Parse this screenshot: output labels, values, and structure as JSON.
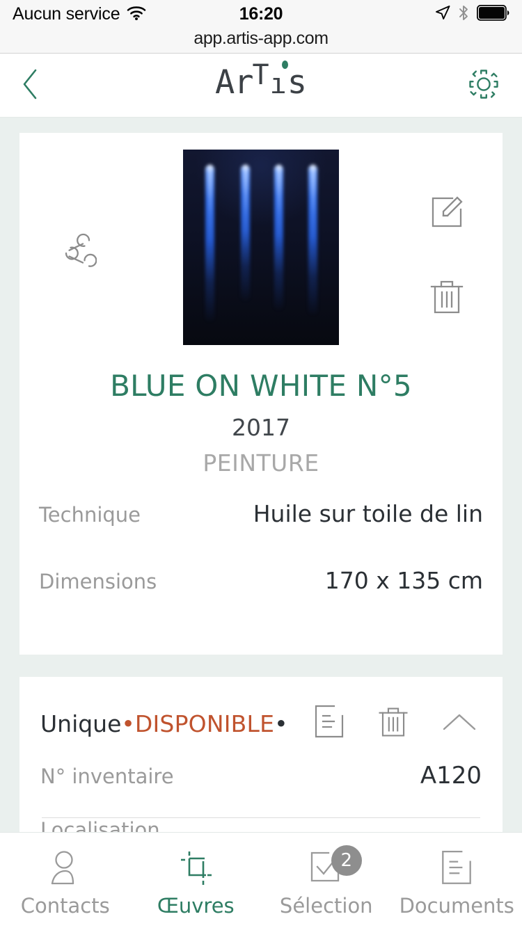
{
  "status_bar": {
    "carrier": "Aucun service",
    "time": "16:20",
    "icons": [
      "wifi-icon",
      "location-arrow-icon",
      "bluetooth-icon",
      "battery-icon"
    ]
  },
  "browser": {
    "url": "app.artis-app.com"
  },
  "header": {
    "back_icon": "chevron-left-icon",
    "logo": {
      "part1": "Ar",
      "part2": "T",
      "part3": "ı",
      "part4": "s"
    },
    "settings_icon": "gear-icon",
    "accent_green": "#2e7d63"
  },
  "artwork": {
    "share_icon": "share-icon",
    "edit_icon": "edit-icon",
    "delete_icon": "trash-icon",
    "image_alt": "blue-on-white-painting-thumbnail",
    "title": "BLUE ON WHITE N°5",
    "year": "2017",
    "category": "PEINTURE",
    "attributes": [
      {
        "label": "Technique",
        "value": "Huile sur toile de lin"
      },
      {
        "label": "Dimensions",
        "value": "170 x 135 cm"
      }
    ]
  },
  "status_card": {
    "edition": "Unique",
    "sep1": "•",
    "availability": "DISPONIBLE",
    "sep2": "•",
    "availability_color": "#c0532e",
    "document_icon": "document-icon",
    "delete_icon": "trash-icon",
    "collapse_icon": "chevron-up-icon",
    "attributes": [
      {
        "label": "N° inventaire",
        "value": "A120"
      },
      {
        "label": "Localisation",
        "value": ""
      }
    ]
  },
  "tab_bar": {
    "tabs": [
      {
        "label": "Contacts",
        "icon": "person-icon",
        "active": false,
        "badge": ""
      },
      {
        "label": "Œuvres",
        "icon": "crop-icon",
        "active": true,
        "badge": ""
      },
      {
        "label": "Sélection",
        "icon": "checkbox-icon",
        "active": false,
        "badge": "2"
      },
      {
        "label": "Documents",
        "icon": "document-icon",
        "active": false,
        "badge": ""
      }
    ]
  }
}
